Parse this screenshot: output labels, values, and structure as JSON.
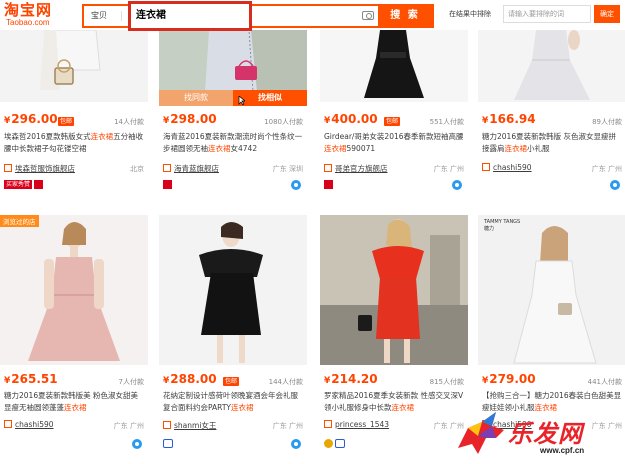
{
  "header": {
    "logo_cn": "淘宝网",
    "logo_en": "Taobao.com",
    "search_category": "宝贝",
    "search_value": "连衣裙",
    "search_button": "搜 索",
    "exclude_label": "在结果中排除",
    "exclude_placeholder": "请输入要排除的词",
    "exclude_button": "确定"
  },
  "row1": [
    {
      "price": "296.00",
      "badge": "包邮",
      "paid": "14人付款",
      "title_a": "埃森哲2016夏款韩版女式",
      "title_hl": "连衣裙",
      "title_b": "五分袖收腰中长款裙子勾花镂空裙",
      "shop": "埃森哲服饰旗舰店",
      "location": "北京",
      "tag": "买家秀赞"
    },
    {
      "price": "298.00",
      "badge": "",
      "paid": "1080人付款",
      "title_a": "海青蓝2016夏装新款潮流时尚个性条纹一步裙圆领无袖",
      "title_hl": "连衣裙",
      "title_b": "女4742",
      "shop": "海青蓝旗舰店",
      "location": "广东 深圳",
      "find_same": "找同款",
      "find_similar": "找相似"
    },
    {
      "price": "400.00",
      "badge": "包邮",
      "paid": "551人付款",
      "title_a": "Girdear/哥弟女装2016春季新款短袖高腰",
      "title_hl": "连衣裙",
      "title_b": "590071",
      "shop": "哥弟官方旗舰店",
      "location": "广东 广州"
    },
    {
      "price": "166.94",
      "badge": "",
      "paid": "89人付款",
      "title_a": "糖力2016夏装新款韩版 灰色淑女显瘦拼接露肩",
      "title_hl": "连衣裙",
      "title_b": "小礼服",
      "shop": "chashi590",
      "location": "广东 广州"
    }
  ],
  "row2": [
    {
      "corner": "浏览过的店",
      "price": "265.51",
      "badge": "",
      "paid": "7人付款",
      "title_a": "糖力2016夏装新款韩版美 粉色淑女甜美显瘦无袖圆领蓬蓬",
      "title_hl": "连衣裙",
      "title_b": "",
      "shop": "chashi590",
      "location": "广东 广州"
    },
    {
      "price": "288.00",
      "badge": "包邮",
      "paid": "144人付款",
      "title_a": "花纳定制设计感荷叶领晚宴酒会年会礼服 复合面料约会PARTY",
      "title_hl": "连衣裙",
      "title_b": "",
      "shop": "shanmi女王",
      "location": "广东 广州"
    },
    {
      "price": "214.20",
      "badge": "",
      "paid": "815人付款",
      "title_a": "罗家精品2016夏季女装新款 性感交叉深V领小礼服修身中长款",
      "title_hl": "连衣裙",
      "title_b": "",
      "shop": "princess_1543",
      "location": "广东 广州"
    },
    {
      "price": "279.00",
      "badge": "",
      "paid": "441人付款",
      "title_a": "【抢购三合一】糖力2016春装白色甜美显瘦娃娃领小礼服",
      "title_hl": "连衣裙",
      "title_b": "",
      "shop": "chashi590",
      "location": "广东 广州",
      "brand_sign": "TAMMY TANGS 糖力"
    }
  ],
  "watermark": {
    "text": "乐发网",
    "url": "www.cpf.cn"
  },
  "colors": {
    "accent": "#ff5000",
    "price": "#ff4400",
    "highlight_border": "#d62d1e"
  }
}
